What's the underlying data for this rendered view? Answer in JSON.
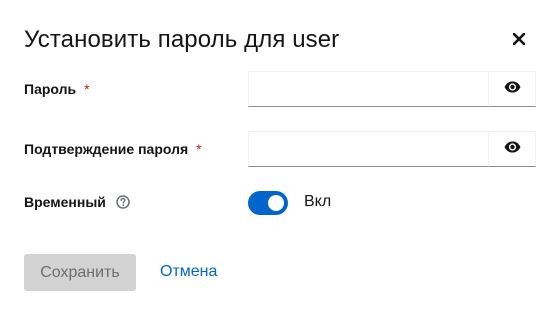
{
  "dialog": {
    "title": "Установить пароль для user",
    "close_icon": "close-icon"
  },
  "form": {
    "password": {
      "label": "Пароль",
      "required_mark": "*",
      "value": "",
      "toggle_icon": "eye-icon"
    },
    "confirm": {
      "label": "Подтверждение пароля",
      "required_mark": "*",
      "value": "",
      "toggle_icon": "eye-icon"
    },
    "temporary": {
      "label": "Временный",
      "help_icon": "help-icon",
      "toggle_on": true,
      "toggle_text": "Вкл"
    }
  },
  "actions": {
    "save_label": "Сохранить",
    "cancel_label": "Отмена"
  },
  "colors": {
    "accent": "#0066cc",
    "required": "#c9190b",
    "disabled_bg": "#d2d2d2"
  }
}
